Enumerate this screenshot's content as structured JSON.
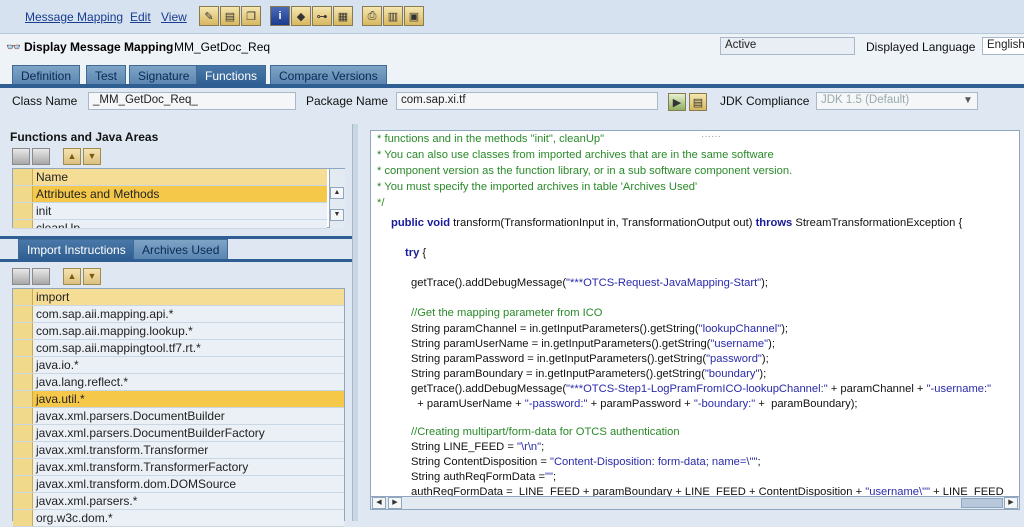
{
  "menu": {
    "items": [
      "Message Mapping",
      "Edit",
      "View"
    ]
  },
  "toolbar": {
    "icons": [
      "edit-pencil-icon",
      "save-icon",
      "copy-icon",
      "info-icon",
      "check-icon",
      "structure-icon",
      "test-icon",
      "print-icon",
      "layout-icon",
      "layout2-icon"
    ]
  },
  "header": {
    "title": "Display Message Mapping",
    "object_name": "MM_GetDoc_Req",
    "status": "Active",
    "language_label": "Displayed Language",
    "language_value": "English"
  },
  "tabs": [
    "Definition",
    "Test",
    "Signature",
    "Functions",
    "Compare Versions"
  ],
  "props": {
    "class_name_label": "Class Name",
    "class_name_value": "_MM_GetDoc_Req_",
    "package_label": "Package Name",
    "package_value": "com.sap.xi.tf",
    "jdk_label": "JDK Compliance",
    "jdk_value": "JDK 1.5 (Default)"
  },
  "functions": {
    "title": "Functions and Java Areas",
    "header": "Name",
    "rows": [
      "Attributes and Methods",
      "init",
      "cleanUp"
    ]
  },
  "imports": {
    "tabs": [
      "Import Instructions",
      "Archives Used"
    ],
    "header": "import",
    "rows": [
      "com.sap.aii.mapping.api.*",
      "com.sap.aii.mapping.lookup.*",
      "com.sap.aii.mappingtool.tf7.rt.*",
      "java.io.*",
      "java.lang.reflect.*",
      "java.util.*",
      "javax.xml.parsers.DocumentBuilder",
      "javax.xml.parsers.DocumentBuilderFactory",
      "javax.xml.transform.Transformer",
      "javax.xml.transform.TransformerFactory",
      "javax.xml.transform.dom.DOMSource",
      "javax.xml.parsers.*",
      "org.w3c.dom.*"
    ]
  },
  "code": {
    "lines": [
      "* functions and in the methods \"init\", cleanUp\"",
      "* You can also use classes from imported archives that are in the same software",
      "* component version as the function library, or in a sub software component version.",
      "* You must specify the imported archives in table 'Archives Used'",
      "*/",
      "public void transform(TransformationInput in, TransformationOutput out) throws StreamTransformationException {",
      "try {",
      "getTrace().addDebugMessage(\"***OTCS-Request-JavaMapping-Start\");",
      "//Get the mapping parameter from ICO",
      "String paramChannel = in.getInputParameters().getString(\"lookupChannel\");",
      "String paramUserName = in.getInputParameters().getString(\"username\");",
      "String paramPassword = in.getInputParameters().getString(\"password\");",
      "String paramBoundary = in.getInputParameters().getString(\"boundary\");",
      "getTrace().addDebugMessage(\"***OTCS-Step1-LogPramFromICO-lookupChannel:\" + paramChannel + \"-username:\"",
      "  + paramUserName + \"-password:\" + paramPassword + \"-boundary:\" +  paramBoundary);",
      "//Creating multipart/form-data for OTCS authentication",
      "String LINE_FEED = \"\\r\\n\";",
      "String ContentDisposition = \"Content-Disposition: form-data; name=\\\"\";",
      "String authReqFormData =\"\";",
      "authReqFormData =  LINE_FEED + paramBoundary + LINE_FEED + ContentDisposition + \"username\\\"\" + LINE_FEED"
    ]
  }
}
